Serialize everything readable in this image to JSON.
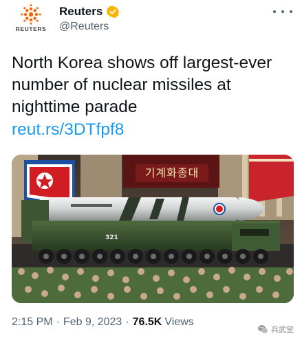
{
  "account": {
    "display_name": "Reuters",
    "handle": "@Reuters",
    "logo_word": "REUTERS",
    "verified_icon": "verified-badge-icon",
    "verified_color": "#f4b400"
  },
  "tweet": {
    "text": "North Korea shows off largest-ever number of nuclear missiles at nighttime parade",
    "link": "reut.rs/3DTfpf8",
    "link_color": "#1d9bf0"
  },
  "photo": {
    "banner_text": "기계화종대",
    "vehicle_number": "321"
  },
  "meta": {
    "time": "2:15 PM",
    "separator": "·",
    "date": "Feb 9, 2023",
    "views_count": "76.5K",
    "views_label": "Views"
  },
  "watermark": {
    "text": "兵武堂",
    "icon": "wechat-icon"
  },
  "icons": {
    "more": "more-options-icon"
  }
}
